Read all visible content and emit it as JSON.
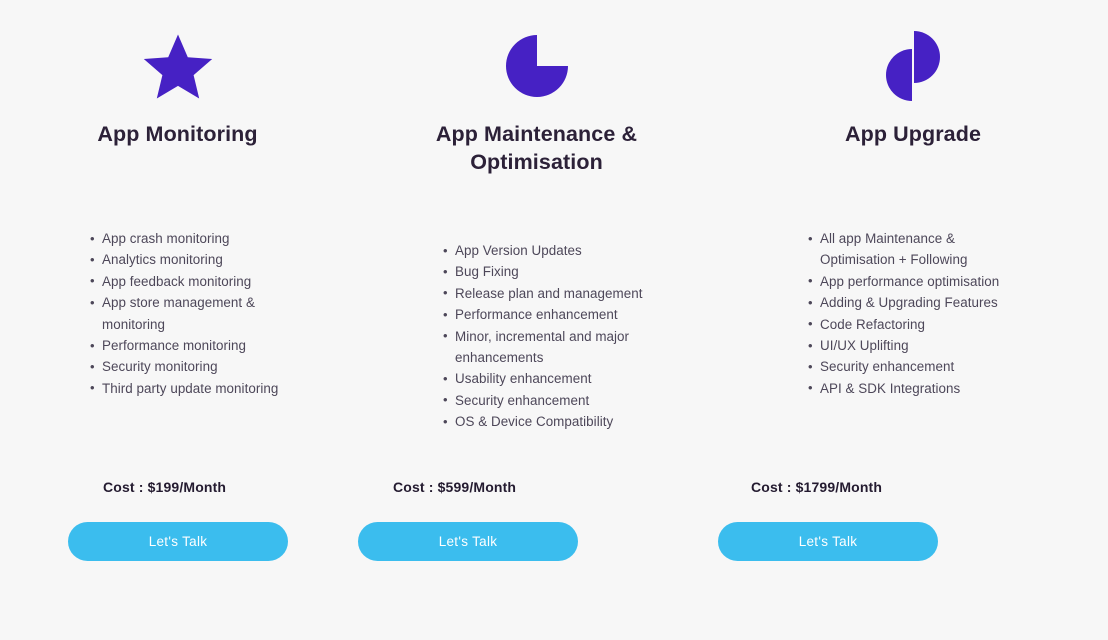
{
  "page": {
    "background_color": "#f7f7f7",
    "accent_purple": "#4621c4",
    "accent_blue": "#3bbdee",
    "heading_color": "#2c2138",
    "body_text_color": "#4d4759",
    "cost_color": "#241b30"
  },
  "plans": [
    {
      "icon": "star-icon",
      "title": "App Monitoring",
      "features": [
        "App crash monitoring",
        "Analytics monitoring",
        "App feedback monitoring",
        "App store management & monitoring",
        "Performance monitoring",
        "Security monitoring",
        "Third party update monitoring"
      ],
      "cost": "Cost : $199/Month",
      "cta_label": "Let's Talk"
    },
    {
      "icon": "pie-chart-icon",
      "title": "App Maintenance & Optimisation",
      "features": [
        "App Version Updates",
        "Bug Fixing",
        "Release plan and management",
        "Performance enhancement",
        "Minor, incremental and major enhancements",
        "Usability enhancement",
        "Security enhancement",
        "OS & Device Compatibility"
      ],
      "cost": "Cost : $599/Month",
      "cta_label": "Let's Talk"
    },
    {
      "icon": "two-half-circles-icon",
      "title": "App Upgrade",
      "features": [
        "All app Maintenance & Optimisation + Following",
        "App performance optimisation",
        "Adding & Upgrading Features",
        "Code Refactoring",
        "UI/UX Uplifting",
        "Security enhancement",
        "API & SDK Integrations"
      ],
      "cost": "Cost : $1799/Month",
      "cta_label": "Let's Talk"
    }
  ]
}
